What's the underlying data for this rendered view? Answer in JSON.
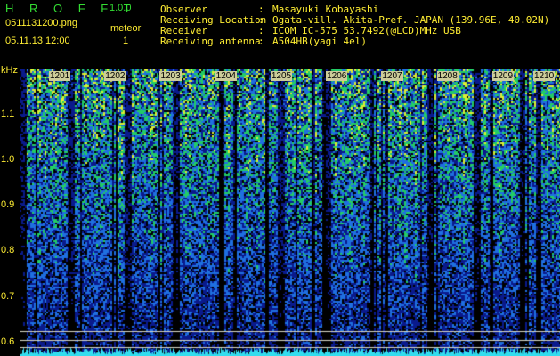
{
  "app": {
    "title": "H R O F F T",
    "version": "1.0.0"
  },
  "file": {
    "name": "0511131200.png",
    "datetime": "05.11.13 12:00"
  },
  "meteor": {
    "label": "meteor",
    "count": "1"
  },
  "metadata": [
    {
      "key": "Observer",
      "sep": ":",
      "value": "Masayuki Kobayashi"
    },
    {
      "key": "Receiving Location",
      "sep": ":",
      "value": "Ogata-vill. Akita-Pref. JAPAN (139.96E, 40.02N)"
    },
    {
      "key": "Receiver",
      "sep": ":",
      "value": "ICOM IC-575 53.7492(@LCD)MHz USB"
    },
    {
      "key": "Receiving antenna",
      "sep": ":",
      "value": "A504HB(yagi 4el)"
    }
  ],
  "spectrogram": {
    "unit": "kHz",
    "y_ticks": [
      "1.1",
      "1.0",
      "0.9",
      "0.8",
      "0.7",
      "0.6"
    ],
    "y_range": [
      0.57,
      1.2
    ],
    "x_ticks": [
      "1201",
      "1202",
      "1203",
      "1204",
      "1205",
      "1206",
      "1207",
      "1208",
      "1209",
      "1210"
    ],
    "colors": {
      "background": "#000000",
      "low": "#0a1a8c",
      "mid": "#1f6fe0",
      "high": "#22cc66",
      "peak": "#ddee33",
      "ref_line": "#d8d8c8"
    },
    "ref_lines_khz": [
      0.625,
      0.605,
      0.59
    ]
  }
}
